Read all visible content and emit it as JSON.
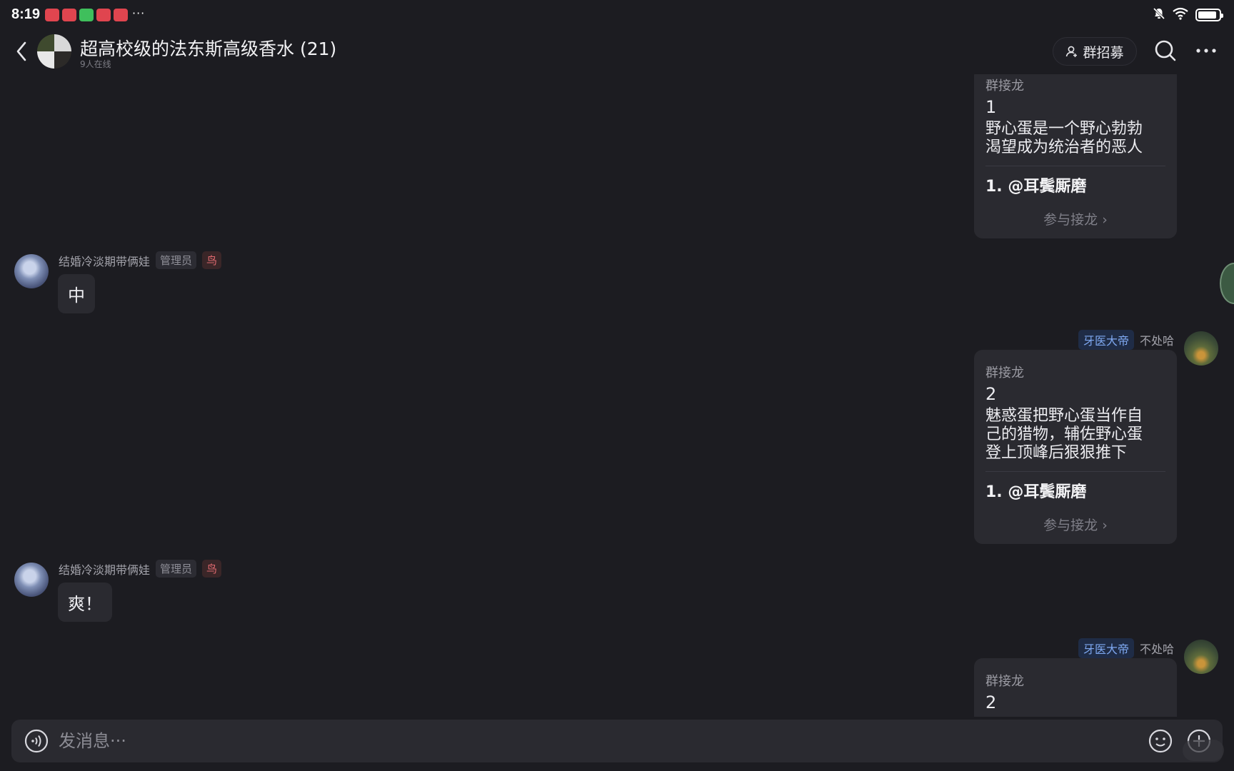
{
  "status_bar": {
    "time": "8:19",
    "more": "···"
  },
  "header": {
    "title": "超高校级的法东斯高级香水 (21)",
    "online": "9人在线",
    "recruit_label": "群招募"
  },
  "messages": [
    {
      "type": "solitaire",
      "kind": "群接龙",
      "number": "1",
      "topic_lines": [
        "野心蛋是一个野心勃勃",
        "渴望成为统治者的恶人"
      ],
      "entry": "1. @耳鬓厮磨",
      "join": "参与接龙"
    },
    {
      "type": "text",
      "sender": "结婚冷淡期带俩娃",
      "role": "管理员",
      "badge": "鸟",
      "text": "中"
    },
    {
      "type": "solitaire",
      "sender_tag": "牙医大帝",
      "sender": "不处哈",
      "kind": "群接龙",
      "number": "2",
      "topic_lines": [
        "魅惑蛋把野心蛋当作自",
        "己的猎物，辅佐野心蛋",
        "登上顶峰后狠狠推下"
      ],
      "entry": "1. @耳鬓厮磨",
      "join": "参与接龙"
    },
    {
      "type": "text",
      "sender": "结婚冷淡期带俩娃",
      "role": "管理员",
      "badge": "鸟",
      "text": "爽！"
    },
    {
      "type": "solitaire",
      "sender_tag": "牙医大帝",
      "sender": "不处哈",
      "kind": "群接龙",
      "number": "2"
    }
  ],
  "input": {
    "placeholder": "发消息···"
  },
  "colors": {
    "background": "#1c1c21",
    "bubble": "#2a2a30",
    "tag_blue": "#7ea8f0",
    "tag_red": "#e0696f"
  },
  "icons": [
    "back-arrow-icon",
    "user-icon",
    "search-icon",
    "more-icon",
    "voice-icon",
    "emoji-icon",
    "plus-icon",
    "bell-off-icon",
    "wifi-icon",
    "battery-icon"
  ]
}
